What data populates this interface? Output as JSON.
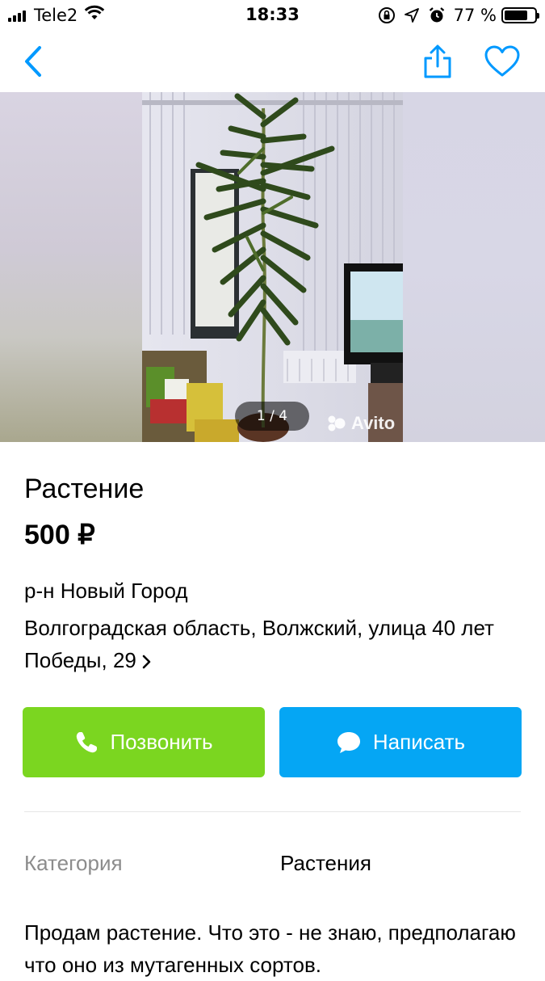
{
  "status_bar": {
    "carrier": "Tele2",
    "time": "18:33",
    "battery_percent": "77 %",
    "battery_level": 0.77,
    "icons": [
      "signal-icon",
      "wifi-icon",
      "rotation-lock-icon",
      "location-icon",
      "alarm-icon",
      "battery-icon"
    ]
  },
  "nav": {
    "icons": [
      "back-chevron-icon",
      "share-icon",
      "heart-icon"
    ],
    "accent_color": "#0099ff"
  },
  "gallery": {
    "counter": "1 / 4",
    "watermark": "Avito"
  },
  "listing": {
    "title": "Растение",
    "price": "500 ₽",
    "district": "р-н Новый Город",
    "address": "Волгоградская область, Волжский, улица 40 лет Победы, 29"
  },
  "actions": {
    "call_label": "Позвонить",
    "call_color": "#7bd620",
    "write_label": "Написать",
    "write_color": "#05a6f4"
  },
  "details": {
    "category_label": "Категория",
    "category_value": "Растения"
  },
  "description": "Продам растение. Что это - не знаю, предполагаю что оно из мутагенных сортов."
}
